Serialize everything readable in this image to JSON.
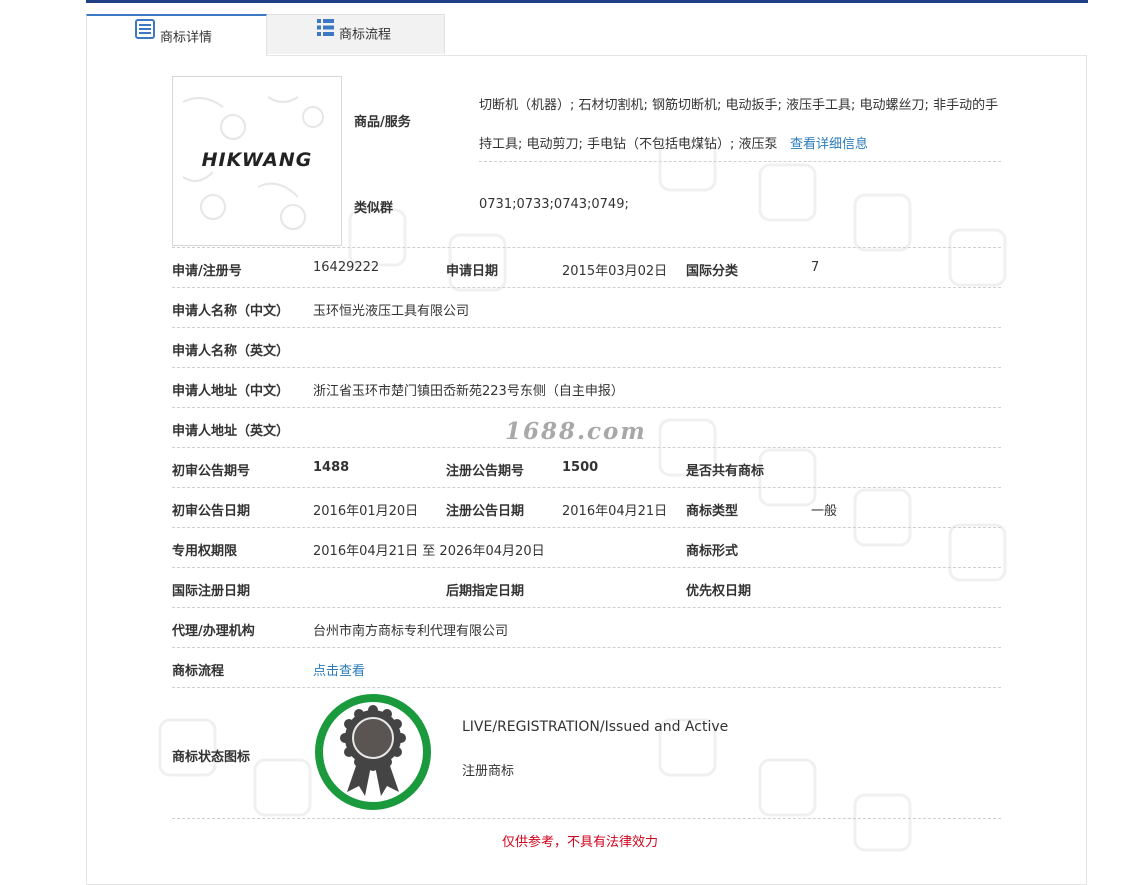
{
  "tabs": [
    {
      "label": "商标详情",
      "icon": "document-icon",
      "active": true
    },
    {
      "label": "商标流程",
      "icon": "list-icon",
      "active": false
    }
  ],
  "logo": {
    "text": "HIKWANG",
    "watermark": "中国商标"
  },
  "goods": {
    "label": "商品/服务",
    "text": "切断机（机器）; 石材切割机; 钢筋切断机; 电动扳手; 液压手工具; 电动螺丝刀; 非手动的手持工具; 电动剪刀; 手电钻（不包括电煤钻）; 液压泵",
    "detail_link": "查看详细信息"
  },
  "similar_group": {
    "label": "类似群",
    "value": "0731;0733;0743;0749;"
  },
  "rows": {
    "reg_no_label": "申请/注册号",
    "reg_no": "16429222",
    "apply_date_label": "申请日期",
    "apply_date": "2015年03月02日",
    "intl_class_label": "国际分类",
    "intl_class": "7",
    "applicant_cn_label": "申请人名称（中文）",
    "applicant_cn": "玉环恒光液压工具有限公司",
    "applicant_en_label": "申请人名称（英文）",
    "applicant_en": "",
    "address_cn_label": "申请人地址（中文）",
    "address_cn": "浙江省玉环市楚门镇田岙新苑223号东侧（自主申报）",
    "address_en_label": "申请人地址（英文）",
    "address_en": "",
    "prelim_no_label": "初审公告期号",
    "prelim_no": "1488",
    "reg_pub_no_label": "注册公告期号",
    "reg_pub_no": "1500",
    "shared_label": "是否共有商标",
    "shared": "",
    "prelim_date_label": "初审公告日期",
    "prelim_date": "2016年01月20日",
    "reg_pub_date_label": "注册公告日期",
    "reg_pub_date": "2016年04月21日",
    "tm_type_label": "商标类型",
    "tm_type": "一般",
    "term_label": "专用权期限",
    "term": "2016年04月21日 至 2026年04月20日",
    "tm_form_label": "商标形式",
    "tm_form": "",
    "intl_reg_date_label": "国际注册日期",
    "intl_reg_date": "",
    "later_designation_label": "后期指定日期",
    "later_designation": "",
    "priority_date_label": "优先权日期",
    "priority_date": "",
    "agent_label": "代理/办理机构",
    "agent": "台州市南方商标专利代理有限公司",
    "flow_label": "商标流程",
    "flow_link": "点击查看"
  },
  "status": {
    "label": "商标状态图标",
    "en": "LIVE/REGISTRATION/Issued and Active",
    "cn": "注册商标",
    "ring_color": "#1a9a3c"
  },
  "watermark_site": "1688.com",
  "disclaimer": "仅供参考，不具有法律效力",
  "colors": {
    "link": "#2a7ab8",
    "disclaimer": "#d0021b",
    "tab_accent": "#3c78c3",
    "top_bar": "#1f3f86"
  }
}
